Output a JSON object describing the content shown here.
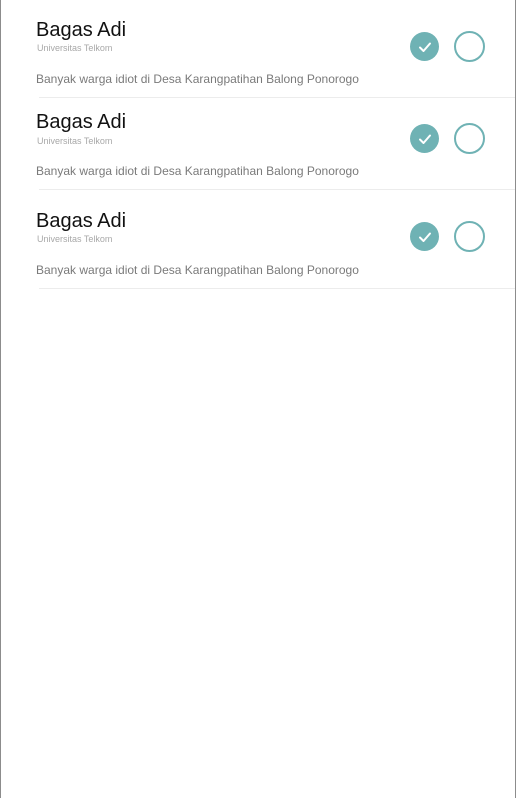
{
  "theme": {
    "accent": "#6fb2b4",
    "text_primary": "#111111",
    "text_secondary": "#7a7a7a"
  },
  "items": [
    {
      "name": "Bagas Adi",
      "organization": "Universitas Telkom",
      "message": "Banyak warga idiot di Desa Karangpatihan Balong Ponorogo",
      "accept_icon": "check-icon",
      "reject_icon": "circle-outline-icon"
    },
    {
      "name": "Bagas Adi",
      "organization": "Universitas Telkom",
      "message": "Banyak warga idiot di Desa Karangpatihan Balong Ponorogo",
      "accept_icon": "check-icon",
      "reject_icon": "circle-outline-icon"
    },
    {
      "name": "Bagas Adi",
      "organization": "Universitas Telkom",
      "message": "Banyak warga idiot di Desa Karangpatihan Balong Ponorogo",
      "accept_icon": "check-icon",
      "reject_icon": "circle-outline-icon"
    }
  ]
}
